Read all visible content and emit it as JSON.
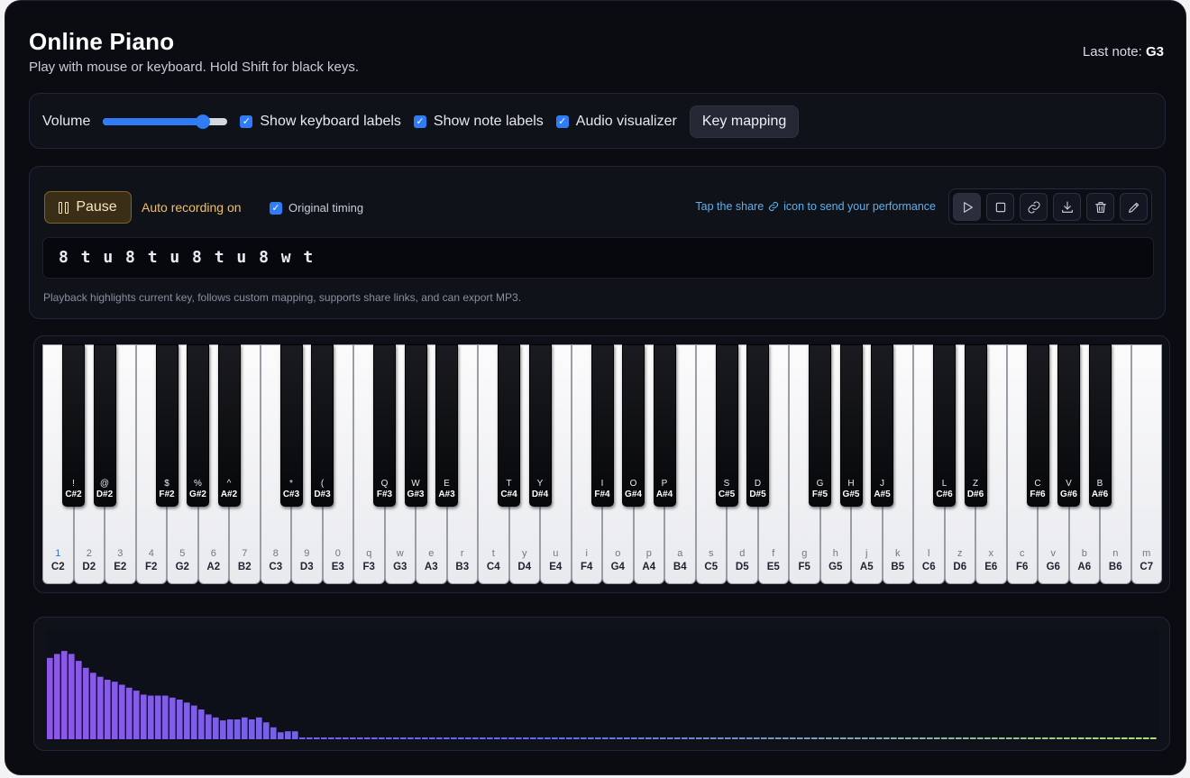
{
  "header": {
    "title": "Online Piano",
    "subtitle": "Play with mouse or keyboard. Hold Shift for black keys.",
    "last_note_label": "Last note:",
    "last_note_value": "G3"
  },
  "controls": {
    "volume_label": "Volume",
    "volume_level": 0.8,
    "show_keyboard_labels": {
      "label": "Show keyboard labels",
      "checked": true
    },
    "show_note_labels": {
      "label": "Show note labels",
      "checked": true
    },
    "audio_visualizer": {
      "label": "Audio visualizer",
      "checked": true
    },
    "key_mapping_button": "Key mapping"
  },
  "recorder": {
    "pause_button": "Pause",
    "auto_recording": "Auto recording on",
    "original_timing": {
      "label": "Original timing",
      "checked": true
    },
    "share_hint_before": "Tap the share",
    "share_hint_after": "icon to send your performance",
    "tools": [
      "play-icon",
      "stop-icon",
      "link-icon",
      "download-icon",
      "trash-icon",
      "edit-icon"
    ],
    "sequence": "8 t u 8 t u 8 t u 8 w t",
    "note": "Playback highlights current key, follows custom mapping, supports share links, and can export MP3."
  },
  "piano": {
    "white_keys": [
      {
        "note": "C2",
        "key": "1"
      },
      {
        "note": "D2",
        "key": "2"
      },
      {
        "note": "E2",
        "key": "3"
      },
      {
        "note": "F2",
        "key": "4"
      },
      {
        "note": "G2",
        "key": "5"
      },
      {
        "note": "A2",
        "key": "6"
      },
      {
        "note": "B2",
        "key": "7"
      },
      {
        "note": "C3",
        "key": "8"
      },
      {
        "note": "D3",
        "key": "9"
      },
      {
        "note": "E3",
        "key": "0"
      },
      {
        "note": "F3",
        "key": "q"
      },
      {
        "note": "G3",
        "key": "w"
      },
      {
        "note": "A3",
        "key": "e"
      },
      {
        "note": "B3",
        "key": "r"
      },
      {
        "note": "C4",
        "key": "t"
      },
      {
        "note": "D4",
        "key": "y"
      },
      {
        "note": "E4",
        "key": "u"
      },
      {
        "note": "F4",
        "key": "i"
      },
      {
        "note": "G4",
        "key": "o"
      },
      {
        "note": "A4",
        "key": "p"
      },
      {
        "note": "B4",
        "key": "a"
      },
      {
        "note": "C5",
        "key": "s"
      },
      {
        "note": "D5",
        "key": "d"
      },
      {
        "note": "E5",
        "key": "f"
      },
      {
        "note": "F5",
        "key": "g"
      },
      {
        "note": "G5",
        "key": "h"
      },
      {
        "note": "A5",
        "key": "j"
      },
      {
        "note": "B5",
        "key": "k"
      },
      {
        "note": "C6",
        "key": "l"
      },
      {
        "note": "D6",
        "key": "z"
      },
      {
        "note": "E6",
        "key": "x"
      },
      {
        "note": "F6",
        "key": "c"
      },
      {
        "note": "G6",
        "key": "v"
      },
      {
        "note": "A6",
        "key": "b"
      },
      {
        "note": "B6",
        "key": "n"
      },
      {
        "note": "C7",
        "key": "m"
      }
    ],
    "black_keys": [
      {
        "note": "C#2",
        "key": "!"
      },
      {
        "note": "D#2",
        "key": "@"
      },
      {
        "note": "F#2",
        "key": "$"
      },
      {
        "note": "G#2",
        "key": "%"
      },
      {
        "note": "A#2",
        "key": "^"
      },
      {
        "note": "C#3",
        "key": "*"
      },
      {
        "note": "D#3",
        "key": "("
      },
      {
        "note": "F#3",
        "key": "Q"
      },
      {
        "note": "G#3",
        "key": "W"
      },
      {
        "note": "A#3",
        "key": "E"
      },
      {
        "note": "C#4",
        "key": "T"
      },
      {
        "note": "D#4",
        "key": "Y"
      },
      {
        "note": "F#4",
        "key": "I"
      },
      {
        "note": "G#4",
        "key": "O"
      },
      {
        "note": "A#4",
        "key": "P"
      },
      {
        "note": "C#5",
        "key": "S"
      },
      {
        "note": "D#5",
        "key": "D"
      },
      {
        "note": "F#5",
        "key": "G"
      },
      {
        "note": "G#5",
        "key": "H"
      },
      {
        "note": "A#5",
        "key": "J"
      },
      {
        "note": "C#6",
        "key": "L"
      },
      {
        "note": "D#6",
        "key": "Z"
      },
      {
        "note": "F#6",
        "key": "C"
      },
      {
        "note": "G#6",
        "key": "V"
      },
      {
        "note": "A#6",
        "key": "B"
      }
    ]
  },
  "visualizer": {
    "levels": [
      0.82,
      0.86,
      0.89,
      0.86,
      0.79,
      0.72,
      0.67,
      0.63,
      0.6,
      0.58,
      0.55,
      0.52,
      0.49,
      0.45,
      0.44,
      0.44,
      0.44,
      0.42,
      0.4,
      0.37,
      0.34,
      0.3,
      0.25,
      0.22,
      0.19,
      0.2,
      0.2,
      0.22,
      0.2,
      0.22,
      0.17,
      0.12,
      0.07,
      0.08,
      0.08
    ],
    "colors": {
      "start": "#8d57e8",
      "mid": "#5b6ee6",
      "end": "#a6e07a"
    }
  }
}
